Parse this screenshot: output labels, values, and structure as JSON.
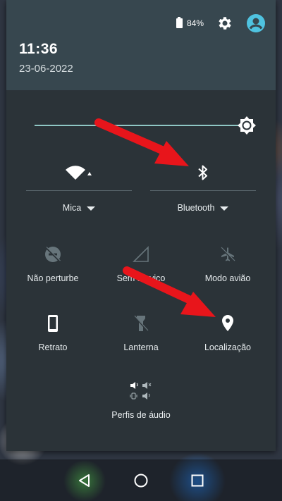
{
  "status": {
    "battery_percent": "84%",
    "battery_level": 0.84,
    "settings_icon": "gear-icon",
    "profile_icon": "account-circle-icon"
  },
  "header": {
    "time": "11:36",
    "date": "23-06-2022"
  },
  "brightness": {
    "level": 0.95,
    "icon": "brightness-icon"
  },
  "big_tiles": [
    {
      "id": "wifi",
      "label": "Mica",
      "icon": "wifi-icon"
    },
    {
      "id": "bluetooth",
      "label": "Bluetooth",
      "icon": "bluetooth-icon"
    }
  ],
  "tiles_row1": [
    {
      "id": "dnd",
      "label": "Não perturbe",
      "icon": "do-not-disturb-off-icon"
    },
    {
      "id": "signal",
      "label": "Sem serviço",
      "icon": "no-signal-icon"
    },
    {
      "id": "airplane",
      "label": "Modo avião",
      "icon": "airplane-off-icon"
    }
  ],
  "tiles_row2": [
    {
      "id": "rotation",
      "label": "Retrato",
      "icon": "portrait-phone-icon"
    },
    {
      "id": "flashlight",
      "label": "Lanterna",
      "icon": "flashlight-off-icon"
    },
    {
      "id": "location",
      "label": "Localização",
      "icon": "location-pin-icon"
    }
  ],
  "audio_tile": {
    "label": "Perfis de áudio",
    "icon": "audio-profiles-icon"
  },
  "navbar": {
    "back_icon": "back-triangle-icon",
    "home_icon": "home-circle-icon",
    "recents_icon": "recents-square-icon"
  },
  "colors": {
    "header_bg": "#37474f",
    "panel_bg": "#2b3338",
    "accent": "#8fc7c4",
    "profile_accent": "#4fc3e0",
    "annotation_arrow": "#e8151b"
  }
}
